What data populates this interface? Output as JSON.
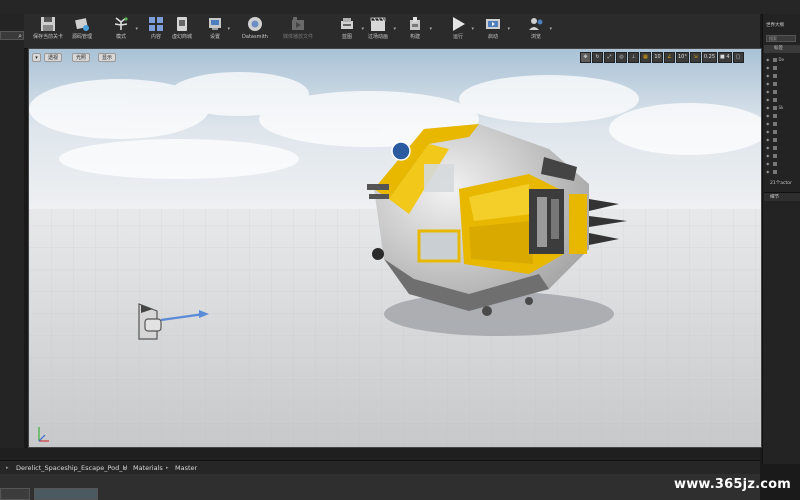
{
  "toolbar": {
    "items": [
      {
        "label": "保存当前关卡",
        "icon": "save-icon"
      },
      {
        "label": "源码管理",
        "icon": "source-control-icon"
      },
      {
        "label": "模式",
        "icon": "modes-icon"
      },
      {
        "label": "内容",
        "icon": "content-icon"
      },
      {
        "label": "虚幻商城",
        "icon": "marketplace-icon"
      },
      {
        "label": "设置",
        "icon": "settings-icon"
      },
      {
        "label": "Datasmith",
        "icon": "datasmith-icon"
      },
      {
        "label": "媒体播放文件",
        "icon": "media-player-icon"
      },
      {
        "label": "蓝图",
        "icon": "blueprint-icon"
      },
      {
        "label": "过场动画",
        "icon": "cinematics-icon"
      },
      {
        "label": "构建",
        "icon": "build-icon"
      },
      {
        "label": "运行",
        "icon": "play-icon"
      },
      {
        "label": "启动",
        "icon": "launch-icon"
      },
      {
        "label": "浏览",
        "icon": "browse-icon"
      }
    ]
  },
  "viewport": {
    "perspective_label": "透视",
    "lit_label": "光照",
    "show_label": "显示",
    "grid_snap_value": "10",
    "rotation_snap_value": "10°",
    "scale_snap_value": "0.25",
    "camera_speed_value": "4"
  },
  "outliner": {
    "title": "世界大纲",
    "search_placeholder": "搜索",
    "column_header": "标签",
    "rows": [
      "De",
      "",
      "",
      "",
      "",
      "",
      "Sk",
      "",
      "",
      "",
      "",
      "",
      "",
      "",
      ""
    ],
    "actor_count": "21个actor",
    "details_tab": "细节"
  },
  "breadcrumb": {
    "items": [
      "Derelict_Spaceship_Escape_Pod_U",
      "Materials",
      "Master"
    ]
  },
  "watermark": "www.365jz.com",
  "colors": {
    "accent_yellow": "#e8b800",
    "axis_red": "#d23a3a",
    "axis_green": "#3ab23a",
    "axis_blue": "#3a6ad2"
  }
}
